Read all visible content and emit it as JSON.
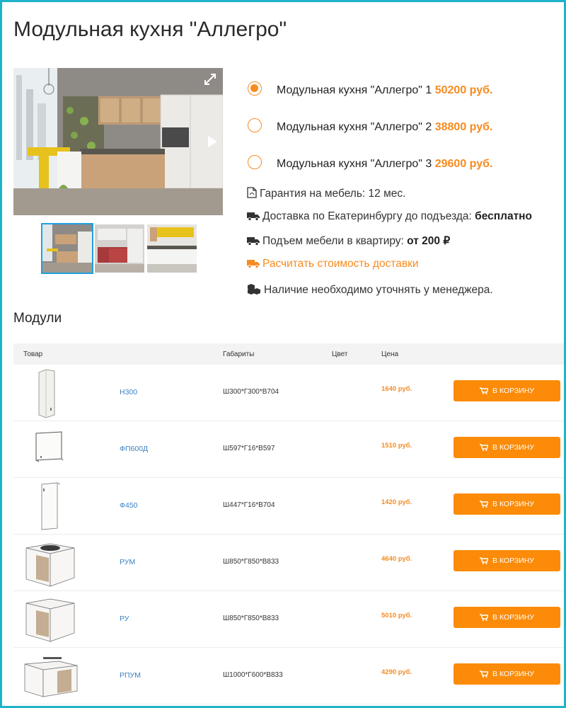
{
  "page_title": "Модульная кухня \"Аллегро\"",
  "options": [
    {
      "label": "Модульная кухня \"Аллегро\" 1",
      "price": "50200 руб.",
      "selected": true
    },
    {
      "label": "Модульная кухня \"Аллегро\" 2",
      "price": "38800 руб.",
      "selected": false
    },
    {
      "label": "Модульная кухня \"Аллегро\" 3",
      "price": "29600 руб.",
      "selected": false
    }
  ],
  "info": {
    "warranty": "Гарантия на мебель: 12 мес.",
    "delivery_label": "Доставка по Екатеринбургу до подъезда:",
    "delivery_value": "бесплатно",
    "lift_label": "Подъем мебели в квартиру:",
    "lift_value": "от 200 ₽",
    "calc_link": "Расчитать стоимость доставки",
    "availability": "Наличие необходимо уточнять у менеджера."
  },
  "modules_title": "Модули",
  "table": {
    "headers": {
      "product": "Товар",
      "dims": "Габариты",
      "color": "Цвет",
      "price": "Цена"
    },
    "cart_label": "В КОРЗИНУ",
    "rows": [
      {
        "name": "Н300",
        "dims": "Ш300*Г300*В704",
        "price": "1640 руб."
      },
      {
        "name": "ФП600Д",
        "dims": "Ш597*Г16*В597",
        "price": "1510 руб."
      },
      {
        "name": "Ф450",
        "dims": "Ш447*Г16*В704",
        "price": "1420 руб."
      },
      {
        "name": "РУМ",
        "dims": "Ш850*Г850*В833",
        "price": "4640 руб."
      },
      {
        "name": "РУ",
        "dims": "Ш850*Г850*В833",
        "price": "5010 руб."
      },
      {
        "name": "РПУМ",
        "dims": "Ш1000*Г600*В833",
        "price": "4290 руб."
      }
    ]
  },
  "colors": {
    "accent": "#f78b1f",
    "button": "#fb8b08",
    "frame": "#1fb3c9",
    "link": "#3a7fc1",
    "thumb_active": "#1ea1e0"
  }
}
